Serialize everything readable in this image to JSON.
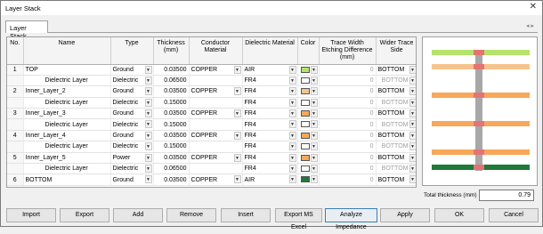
{
  "window": {
    "title": "Layer Stack",
    "close_glyph": "✕"
  },
  "tab": {
    "label": "Layer Stack",
    "arrows": "◂ ▸"
  },
  "columns": [
    "No.",
    "Name",
    "Type",
    "Thickness (mm)",
    "Conductor Material",
    "Dielectric Material",
    "Color",
    "Trace Width Etching Difference (mm)",
    "Wider Trace Side"
  ],
  "rows": [
    {
      "no": "1",
      "name": "TOP",
      "type": "Ground",
      "thickness": "0.03500",
      "conductor": "COPPER",
      "dielectric": "AIR",
      "color": "#b5e36b",
      "etch": "0",
      "side": "BOTTOM"
    },
    {
      "no": "",
      "name": "Dielectric Layer",
      "type": "Dielectric",
      "thickness": "0.06500",
      "conductor": "",
      "dielectric": "FR4",
      "color": "#ffffff",
      "etch": "0",
      "side": "BOTTOM"
    },
    {
      "no": "2",
      "name": "Inner_Layer_2",
      "type": "Ground",
      "thickness": "0.03500",
      "conductor": "COPPER",
      "dielectric": "FR4",
      "color": "#f7c48e",
      "etch": "0",
      "side": "BOTTOM"
    },
    {
      "no": "",
      "name": "Dielectric Layer",
      "type": "Dielectric",
      "thickness": "0.15000",
      "conductor": "",
      "dielectric": "FR4",
      "color": "#ffffff",
      "etch": "0",
      "side": "BOTTOM"
    },
    {
      "no": "3",
      "name": "Inner_Layer_3",
      "type": "Ground",
      "thickness": "0.03500",
      "conductor": "COPPER",
      "dielectric": "FR4",
      "color": "#f7a85a",
      "etch": "0",
      "side": "BOTTOM"
    },
    {
      "no": "",
      "name": "Dielectric Layer",
      "type": "Dielectric",
      "thickness": "0.15000",
      "conductor": "",
      "dielectric": "FR4",
      "color": "#ffffff",
      "etch": "0",
      "side": "BOTTOM"
    },
    {
      "no": "4",
      "name": "Inner_Layer_4",
      "type": "Ground",
      "thickness": "0.03500",
      "conductor": "COPPER",
      "dielectric": "FR4",
      "color": "#f7a85a",
      "etch": "0",
      "side": "BOTTOM"
    },
    {
      "no": "",
      "name": "Dielectric Layer",
      "type": "Dielectric",
      "thickness": "0.15000",
      "conductor": "",
      "dielectric": "FR4",
      "color": "#ffffff",
      "etch": "0",
      "side": "BOTTOM"
    },
    {
      "no": "5",
      "name": "Inner_Layer_5",
      "type": "Power",
      "thickness": "0.03500",
      "conductor": "COPPER",
      "dielectric": "FR4",
      "color": "#f7a85a",
      "etch": "0",
      "side": "BOTTOM"
    },
    {
      "no": "",
      "name": "Dielectric Layer",
      "type": "Dielectric",
      "thickness": "0.06500",
      "conductor": "",
      "dielectric": "FR4",
      "color": "#ffffff",
      "etch": "0",
      "side": "BOTTOM"
    },
    {
      "no": "6",
      "name": "BOTTOM",
      "type": "Ground",
      "thickness": "0.03500",
      "conductor": "COPPER",
      "dielectric": "AIR",
      "color": "#1f7a3a",
      "etch": "0",
      "side": "BOTTOM"
    }
  ],
  "preview_layers": [
    "#b5e36b",
    "#f7c48e",
    "#f7a85a",
    "#f7a85a",
    "#f7a85a",
    "#1f7a3a"
  ],
  "total": {
    "label": "Total thickness (mm)",
    "value": "0.79"
  },
  "buttons": [
    "Import",
    "Export",
    "Add",
    "Remove",
    "Insert",
    "Export MS Excel",
    "Analyze Impedance",
    "Apply",
    "OK",
    "Cancel"
  ]
}
